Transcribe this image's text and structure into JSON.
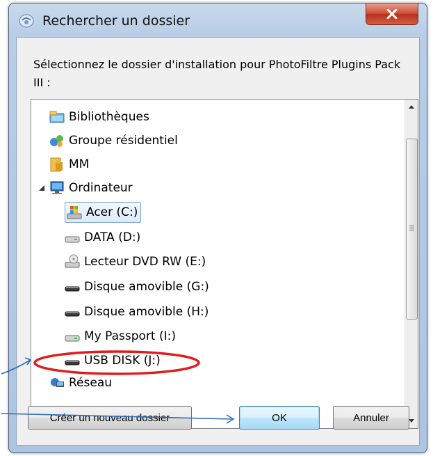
{
  "window": {
    "title": "Rechercher un dossier",
    "close_label": "x"
  },
  "prompt": "Sélectionnez le dossier d'installation pour PhotoFiltre Plugins Pack III :",
  "tree": {
    "items": [
      {
        "label": "Bibliothèques",
        "icon": "libraries-icon",
        "expander": "closed",
        "level": 0
      },
      {
        "label": "Groupe résidentiel",
        "icon": "homegroup-icon",
        "expander": "closed",
        "level": 0
      },
      {
        "label": "MM",
        "icon": "user-folder-icon",
        "expander": "closed",
        "level": 0
      },
      {
        "label": "Ordinateur",
        "icon": "computer-icon",
        "expander": "open",
        "level": 0
      },
      {
        "label": "Acer (C:)",
        "icon": "system-drive-icon",
        "expander": "closed",
        "level": 1,
        "selected": true
      },
      {
        "label": "DATA (D:)",
        "icon": "hard-drive-icon",
        "expander": "closed",
        "level": 1
      },
      {
        "label": "Lecteur DVD RW (E:)",
        "icon": "dvd-drive-icon",
        "expander": "closed",
        "level": 1
      },
      {
        "label": "Disque amovible (G:)",
        "icon": "removable-drive-icon",
        "expander": "closed",
        "level": 1
      },
      {
        "label": "Disque amovible (H:)",
        "icon": "removable-drive-icon",
        "expander": "closed",
        "level": 1
      },
      {
        "label": "My Passport (I:)",
        "icon": "hard-drive-icon",
        "expander": "closed",
        "level": 1
      },
      {
        "label": "USB DISK (J:)",
        "icon": "removable-drive-icon",
        "expander": "closed",
        "level": 1,
        "highlighted": true
      },
      {
        "label": "Réseau",
        "icon": "network-icon",
        "expander": "closed",
        "level": 0
      }
    ]
  },
  "buttons": {
    "new_folder": "Créer un nouveau dossier",
    "ok": "OK",
    "cancel": "Annuler"
  },
  "colors": {
    "annotation_red": "#e11c1c",
    "annotation_arrow": "#2a6fb8",
    "selection_border": "#7da2ce"
  }
}
